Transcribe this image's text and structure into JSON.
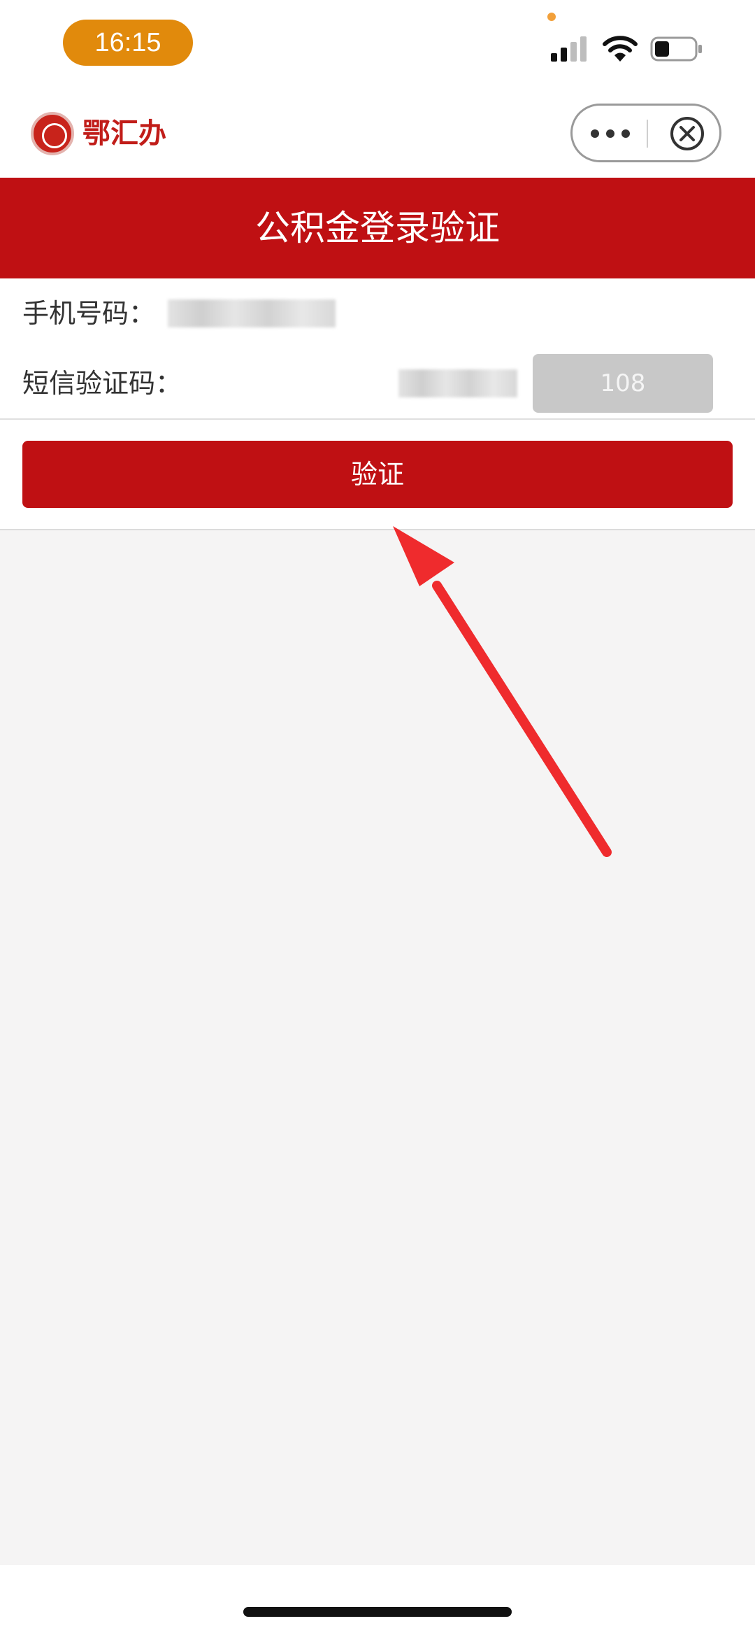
{
  "status_bar": {
    "time": "16:15",
    "accent_color": "#e18a0c"
  },
  "app_header": {
    "logo_text": "鄂汇办",
    "brand_color": "#c11d19",
    "icons": [
      "logo-icon",
      "more-icon",
      "close-icon"
    ]
  },
  "page": {
    "title": "公积金登录验证",
    "banner_color": "#bf1013"
  },
  "form": {
    "phone_label": "手机号码：",
    "sms_label": "短信验证码：",
    "code_button_label": "108",
    "verify_button_label": "验证"
  }
}
